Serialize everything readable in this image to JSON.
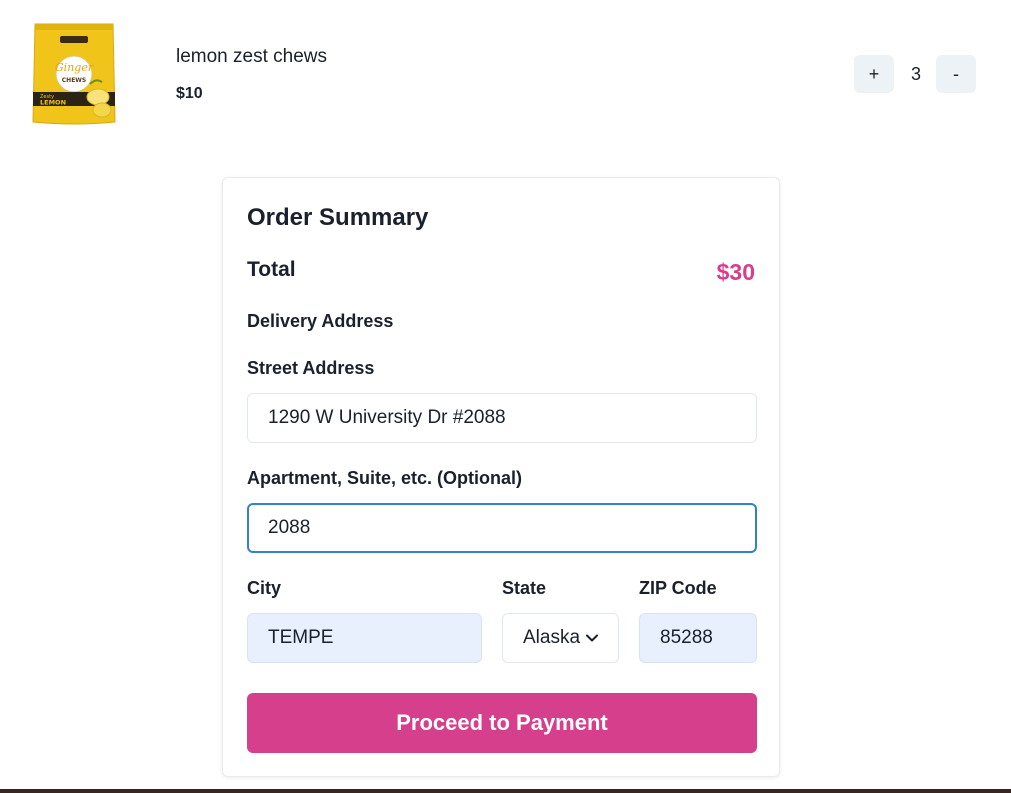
{
  "cart_item": {
    "name": "lemon zest chews",
    "price": "$10",
    "quantity": "3",
    "plus_label": "+",
    "minus_label": "-",
    "image": {
      "package_color": "#f0c419",
      "brand_script": "Ginger",
      "brand_word": "CHEWS",
      "flavor_small": "Zesty",
      "flavor_big": "LEMON"
    }
  },
  "summary": {
    "title": "Order Summary",
    "total_label": "Total",
    "total_value": "$30",
    "delivery_heading": "Delivery Address",
    "street": {
      "label": "Street Address",
      "value": "1290 W University Dr #2088"
    },
    "apartment": {
      "label": "Apartment, Suite, etc. (Optional)",
      "value": "2088"
    },
    "city": {
      "label": "City",
      "value": "TEMPE"
    },
    "state": {
      "label": "State",
      "value": "Alaska"
    },
    "zip": {
      "label": "ZIP Code",
      "value": "85288"
    },
    "proceed_label": "Proceed to Payment"
  },
  "colors": {
    "accent": "#d53f8c",
    "focus": "#3182ce",
    "autofill": "#e8f0fe",
    "qty_button_bg": "#edf2f7"
  }
}
